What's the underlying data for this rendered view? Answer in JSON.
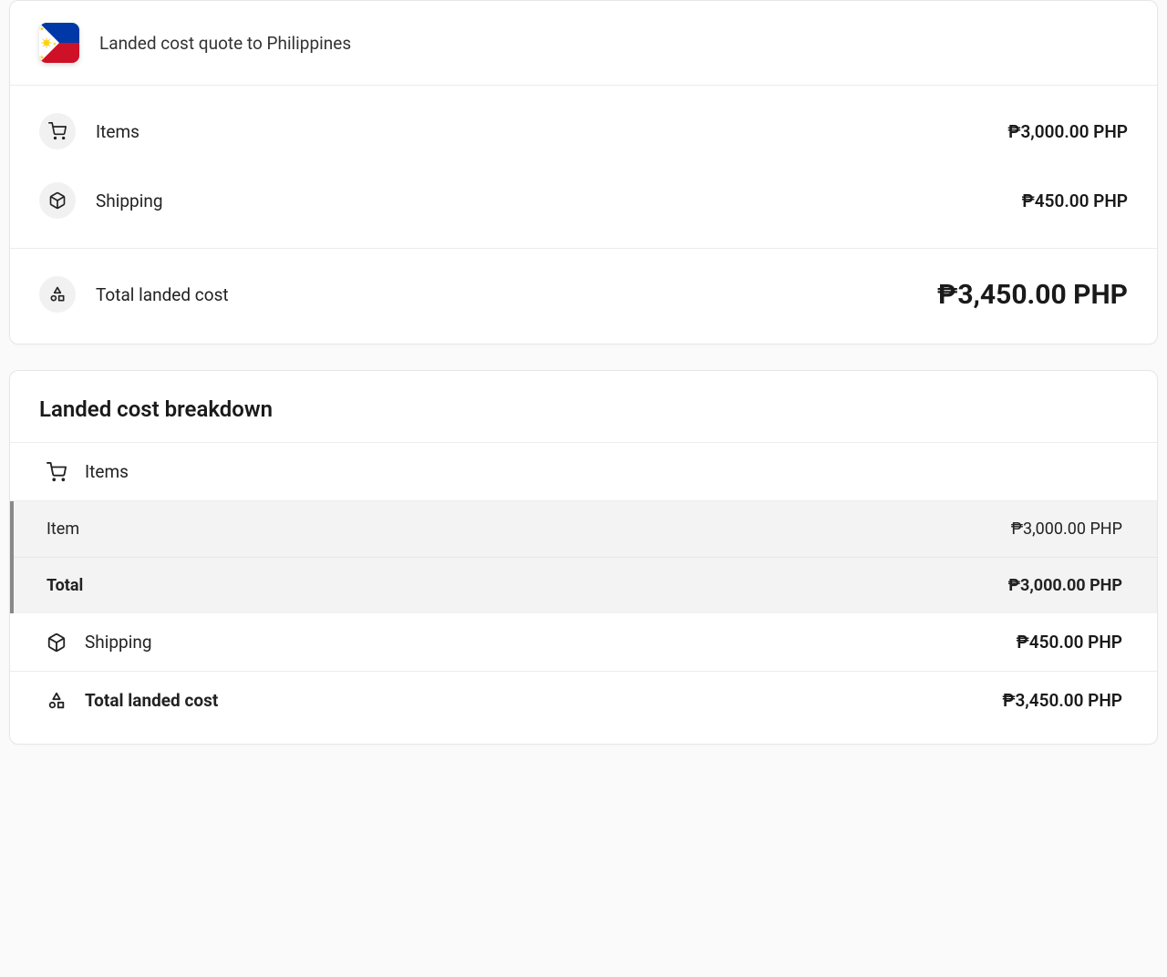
{
  "quote": {
    "title": "Landed cost quote to Philippines",
    "rows": [
      {
        "label": "Items",
        "value": "₱3,000.00 PHP"
      },
      {
        "label": "Shipping",
        "value": "₱450.00 PHP"
      }
    ],
    "total_label": "Total landed cost",
    "total_value": "₱3,450.00 PHP"
  },
  "breakdown": {
    "title": "Landed cost breakdown",
    "items_group": {
      "label": "Items",
      "rows": [
        {
          "label": "Item",
          "value": "₱3,000.00 PHP"
        }
      ],
      "total_label": "Total",
      "total_value": "₱3,000.00 PHP"
    },
    "shipping": {
      "label": "Shipping",
      "value": "₱450.00 PHP"
    },
    "total": {
      "label": "Total landed cost",
      "value": "₱3,450.00 PHP"
    }
  }
}
